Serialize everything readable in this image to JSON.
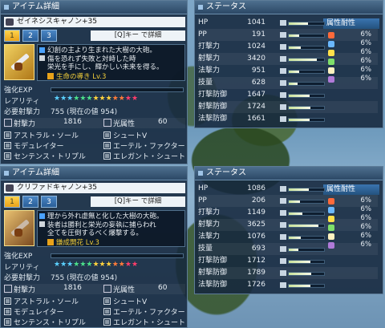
{
  "panels": [
    {
      "title": "アイテム詳細",
      "weapon_name": "ゼイネシスキャノン+35",
      "tabs": [
        "1",
        "2",
        "3"
      ],
      "active_tab": 0,
      "key_hint": "[Q]キー で詳細",
      "description": "幻創の主より生まれた大樹の大砲。\n傷を恐れず失敗と対峙した時\n栄光を手にし、輝かしい未来を得る。",
      "potential": "生命の導き Lv.3",
      "exp_label": "強化EXP",
      "rarity_label": "レアリティ",
      "req_label": "必要射撃力",
      "req_value": "755 (現在の値 954)",
      "atk_label": "射撃力",
      "atk_value": "1816",
      "elem_label": "光属性",
      "elem_value": "60",
      "affixes": [
        "アストラル・ソール",
        "シュートV",
        "モデュレイター",
        "エーテル・ファクター",
        "センテンス・トリプル",
        "エレガント・シュート"
      ]
    },
    {
      "title": "アイテム詳細",
      "weapon_name": "クリファドキャノン+35",
      "tabs": [
        "1",
        "2",
        "3"
      ],
      "active_tab": 0,
      "key_hint": "[Q]キー で詳細",
      "description": "理から外れ虚無と化した大樹の大砲。\n装者は勝利と栄光の妄執に捕らわれ\n全てを圧倒するべく爆撃する。",
      "potential": "鎌成開花 Lv.3",
      "exp_label": "強化EXP",
      "rarity_label": "レアリティ",
      "req_label": "必要射撃力",
      "req_value": "755 (現在の値 954)",
      "atk_label": "射撃力",
      "atk_value": "1816",
      "elem_label": "光属性",
      "elem_value": "60",
      "affixes": [
        "アストラル・ソール",
        "シュートV",
        "モデュレイター",
        "エーテル・ファクター",
        "センテンス・トリプル",
        "エレガント・シュート"
      ]
    }
  ],
  "status_panels": [
    {
      "title": "ステータス",
      "rows": [
        {
          "label": "HP",
          "value": "1041",
          "level": 0.55
        },
        {
          "label": "PP",
          "value": "191",
          "level": 0.3
        },
        {
          "label": "打撃力",
          "value": "1024",
          "level": 0.35
        },
        {
          "label": "射撃力",
          "value": "3420",
          "level": 0.8
        },
        {
          "label": "法撃力",
          "value": "951",
          "level": 0.3
        },
        {
          "label": "技量",
          "value": "628",
          "level": 0.25
        },
        {
          "label": "打撃防御",
          "value": "1647",
          "level": 0.6
        },
        {
          "label": "射撃防御",
          "value": "1724",
          "level": 0.62
        },
        {
          "label": "法撃防御",
          "value": "1661",
          "level": 0.6
        }
      ],
      "resist_title": "属性耐性",
      "resists": [
        "6%",
        "6%",
        "6%",
        "6%",
        "6%",
        "6%"
      ]
    },
    {
      "title": "ステータス",
      "rows": [
        {
          "label": "HP",
          "value": "1086",
          "level": 0.57
        },
        {
          "label": "PP",
          "value": "206",
          "level": 0.32
        },
        {
          "label": "打撃力",
          "value": "1149",
          "level": 0.38
        },
        {
          "label": "射撃力",
          "value": "3625",
          "level": 0.85
        },
        {
          "label": "法撃力",
          "value": "1076",
          "level": 0.33
        },
        {
          "label": "技量",
          "value": "693",
          "level": 0.27
        },
        {
          "label": "打撃防御",
          "value": "1712",
          "level": 0.62
        },
        {
          "label": "射撃防御",
          "value": "1789",
          "level": 0.64
        },
        {
          "label": "法撃防御",
          "value": "1726",
          "level": 0.62
        }
      ],
      "resist_title": "属性耐性",
      "resists": [
        "6%",
        "6%",
        "6%",
        "6%",
        "6%",
        "6%"
      ]
    }
  ],
  "rarity_stars": 13,
  "colors": {
    "star_colors": [
      "#5bd1ff",
      "#5bd1ff",
      "#5bd1ff",
      "#4be08a",
      "#4be08a",
      "#4be08a",
      "#ffd23d",
      "#ffd23d",
      "#ffd23d",
      "#ff7a3a",
      "#ff7a3a",
      "#ff3d6a",
      "#ff3d6a"
    ],
    "resist_icons": [
      "#ff6a3a",
      "#6ab8ff",
      "#ffe04a",
      "#7ee06a",
      "#fff2c0",
      "#b07ad8"
    ]
  }
}
